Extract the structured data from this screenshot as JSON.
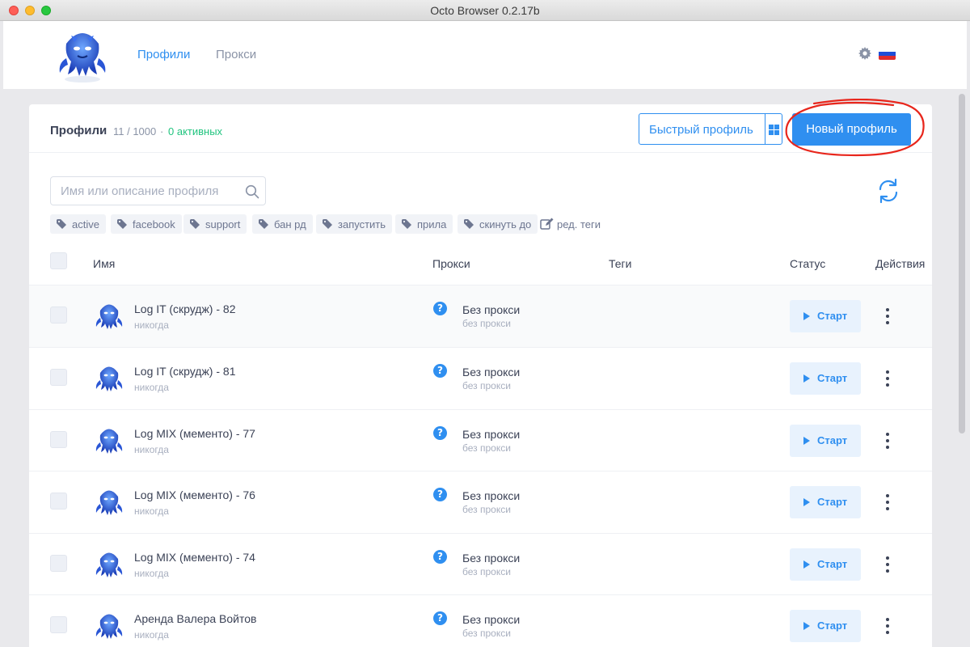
{
  "window": {
    "title": "Octo Browser 0.2.17b"
  },
  "nav": {
    "tabs": [
      {
        "label": "Профили"
      },
      {
        "label": "Прокси"
      }
    ]
  },
  "header": {
    "language": "ru"
  },
  "toolbar": {
    "title": "Профили",
    "count": "11 / 1000",
    "separator": "·",
    "active": "0 активных",
    "quick_profile_label": "Быстрый профиль",
    "new_profile_label": "Новый профиль"
  },
  "search": {
    "placeholder": "Имя или описание профиля",
    "value": ""
  },
  "tags": [
    {
      "label": "active"
    },
    {
      "label": "facebook"
    },
    {
      "label": "support"
    },
    {
      "label": "бан рд"
    },
    {
      "label": "запустить"
    },
    {
      "label": "прила"
    },
    {
      "label": "скинуть до"
    }
  ],
  "edit_tags_label": "ред. теги",
  "table": {
    "columns": {
      "name": "Имя",
      "proxy": "Прокси",
      "tags": "Теги",
      "status": "Статус",
      "actions": "Действия"
    },
    "rows": [
      {
        "name": "Log IT (скрудж) - 82",
        "last_run": "никогда",
        "proxy": "Без прокси",
        "proxy_sub": "без прокси",
        "start_label": "Старт"
      },
      {
        "name": "Log IT (скрудж) - 81",
        "last_run": "никогда",
        "proxy": "Без прокси",
        "proxy_sub": "без прокси",
        "start_label": "Старт"
      },
      {
        "name": "Log MIX (мементо) - 77",
        "last_run": "никогда",
        "proxy": "Без прокси",
        "proxy_sub": "без прокси",
        "start_label": "Старт"
      },
      {
        "name": "Log MIX (мементо) - 76",
        "last_run": "никогда",
        "proxy": "Без прокси",
        "proxy_sub": "без прокси",
        "start_label": "Старт"
      },
      {
        "name": "Log MIX (мементо) - 74",
        "last_run": "никогда",
        "proxy": "Без прокси",
        "proxy_sub": "без прокси",
        "start_label": "Старт"
      },
      {
        "name": "Аренда Валера Войтов",
        "last_run": "никогда",
        "proxy": "Без прокси",
        "proxy_sub": "без прокси",
        "start_label": "Старт"
      }
    ]
  },
  "colors": {
    "accent": "#2f8ff0",
    "active_green": "#21c47f",
    "annotation_red": "#e8261c"
  }
}
